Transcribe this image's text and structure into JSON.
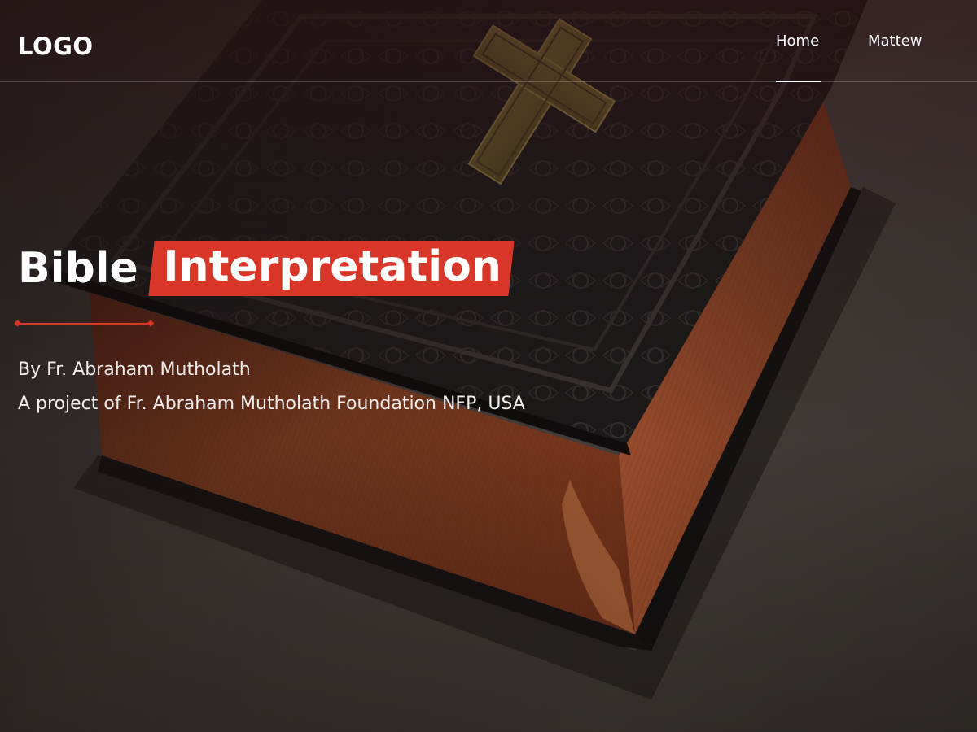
{
  "header": {
    "logo": "LOGO",
    "nav": [
      {
        "label": "Home",
        "active": true
      },
      {
        "label": "Mattew",
        "active": false
      }
    ]
  },
  "hero": {
    "title_plain": "Bible",
    "title_highlight": "Interpretation",
    "author": "By Fr. Abraham Mutholath",
    "project": "A project of Fr. Abraham Mutholath Foundation NFP, USA"
  },
  "colors": {
    "accent": "#d9362a",
    "text": "#ffffff"
  },
  "icons": {
    "background": "bible-book-with-cross-photo"
  }
}
